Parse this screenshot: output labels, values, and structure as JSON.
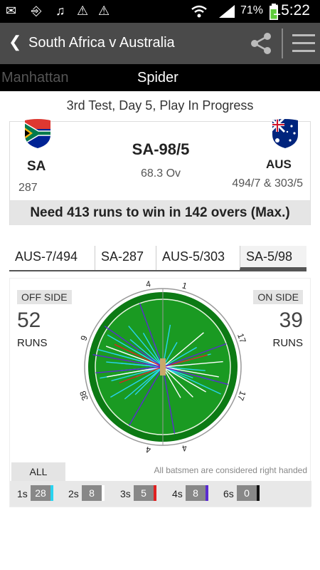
{
  "status_bar": {
    "time": "15:22",
    "battery_percent": "71%",
    "icons": [
      "mail-icon",
      "usb-icon",
      "music-icon",
      "warning-icon",
      "warning-icon",
      "wifi-icon",
      "signal-icon",
      "battery-icon"
    ]
  },
  "action_bar": {
    "title": "South Africa v Australia",
    "back_icon": "back-icon",
    "share_icon": "share-icon",
    "menu_icon": "menu-icon"
  },
  "tabs": [
    {
      "label": "Manhattan",
      "active": false
    },
    {
      "label": "Spider",
      "active": true
    }
  ],
  "match": {
    "status": "3rd Test, Day 5, Play In Progress",
    "home": {
      "code": "SA",
      "score": "287"
    },
    "away": {
      "code": "AUS",
      "score": "494/7 & 303/5"
    },
    "current_score": "SA-98/5",
    "overs": "68.3 Ov",
    "need": "Need 413 runs to win in 142 overs (Max.)"
  },
  "innings_tabs": [
    {
      "label": "AUS-7/494",
      "active": false
    },
    {
      "label": "SA-287",
      "active": false
    },
    {
      "label": "AUS-5/303",
      "active": false
    },
    {
      "label": "SA-5/98",
      "active": true
    }
  ],
  "spider": {
    "off_side": {
      "title": "OFF SIDE",
      "runs": "52",
      "label": "RUNS"
    },
    "on_side": {
      "title": "ON SIDE",
      "runs": "39",
      "label": "RUNS"
    },
    "fielding_labels": [
      "4",
      "1",
      "17",
      "17",
      "4",
      "4",
      "38",
      "9"
    ],
    "filter_label": "ALL",
    "note": "All batsmen are considered right handed",
    "legend": [
      {
        "label": "1s",
        "count": "28",
        "color": "#29d3f0"
      },
      {
        "label": "2s",
        "count": "8",
        "color": "#ffffff"
      },
      {
        "label": "3s",
        "count": "5",
        "color": "#e02020"
      },
      {
        "label": "4s",
        "count": "8",
        "color": "#5a2bd0"
      },
      {
        "label": "6s",
        "count": "0",
        "color": "#111111"
      }
    ],
    "colors": {
      "field": "#1a9a22",
      "outfield": "#0c7a14",
      "pitch": "#c9a86a"
    }
  }
}
